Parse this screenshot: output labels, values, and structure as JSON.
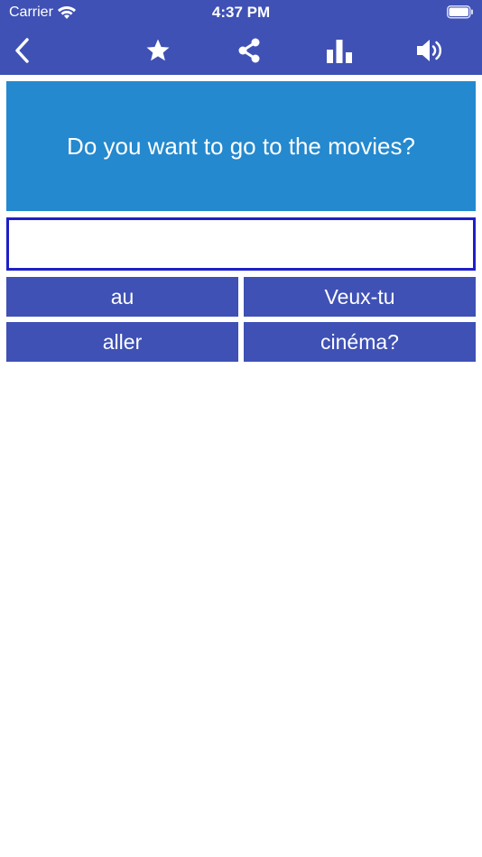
{
  "status_bar": {
    "carrier": "Carrier",
    "time": "4:37 PM"
  },
  "toolbar": {
    "icons": [
      "back-chevron-icon",
      "star-icon",
      "share-icon",
      "bar-chart-icon",
      "speaker-icon"
    ]
  },
  "question": {
    "text": "Do you want to go to the movies?"
  },
  "answer": {
    "value": "",
    "placeholder": ""
  },
  "word_tiles": [
    "au",
    "Veux-tu",
    "aller",
    "cinéma?"
  ],
  "colors": {
    "header": "#3f51b5",
    "question_card": "#2489ce",
    "answer_border": "#1f1fc8",
    "tile": "#3f51b5",
    "text_on_color": "#ffffff"
  }
}
